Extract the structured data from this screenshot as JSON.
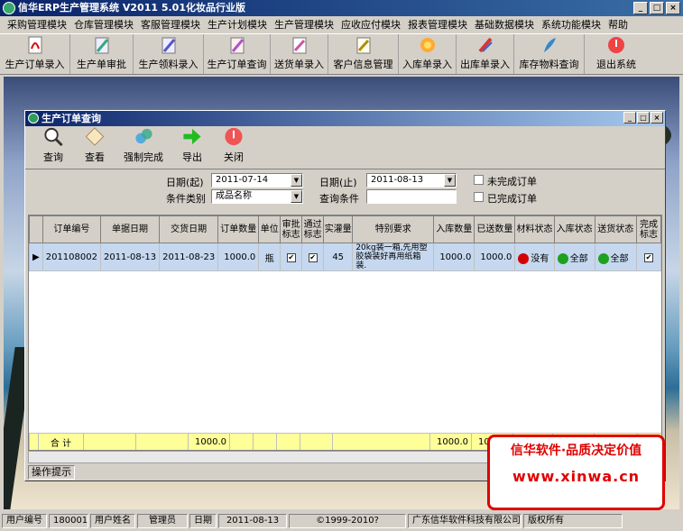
{
  "app": {
    "title": "信华ERP生产管理系统  V2011 5.01化妆品行业版"
  },
  "menu": [
    "采购管理模块",
    "仓库管理模块",
    "客服管理模块",
    "生产计划模块",
    "生产管理模块",
    "应收应付模块",
    "报表管理模块",
    "基础数据模块",
    "系统功能模块",
    "帮助"
  ],
  "toolbar": [
    {
      "label": "生产订单录入",
      "icon": "pdf-document-icon"
    },
    {
      "label": "生产单审批",
      "icon": "pen-approve-icon"
    },
    {
      "label": "生产领料录入",
      "icon": "pen-document-icon"
    },
    {
      "label": "生产订单查询",
      "icon": "pen-search-icon"
    },
    {
      "label": "送货单录入",
      "icon": "delivery-document-icon"
    },
    {
      "label": "客户信息管理",
      "icon": "customer-pen-icon"
    },
    {
      "label": "入库单录入",
      "icon": "flower-document-icon"
    },
    {
      "label": "出库单录入",
      "icon": "outbound-pen-icon"
    },
    {
      "label": "库存物料查询",
      "icon": "feather-pen-icon"
    },
    {
      "label": "退出系统",
      "icon": "exit-icon"
    }
  ],
  "child": {
    "title": "生产订单查询",
    "tools": [
      {
        "label": "查询",
        "icon": "magnifier-icon"
      },
      {
        "label": "查看",
        "icon": "view-diamond-icon"
      },
      {
        "label": "强制完成",
        "icon": "force-complete-icon"
      },
      {
        "label": "导出",
        "icon": "export-arrow-icon"
      },
      {
        "label": "关闭",
        "icon": "close-power-icon"
      }
    ],
    "filters": {
      "date_from_label": "日期(起)",
      "date_from": "2011-07-14",
      "date_to_label": "日期(止)",
      "date_to": "2011-08-13",
      "category_label": "条件类别",
      "category": "成品名称",
      "query_label": "查询条件",
      "query": "",
      "unfinished_label": "未完成订单",
      "finished_label": "已完成订单"
    },
    "columns": [
      "订单编号",
      "单据日期",
      "交货日期",
      "订单数量",
      "单位",
      "审批标志",
      "通过标志",
      "实灌量",
      "特别要求",
      "入库数量",
      "已送数量",
      "材料状态",
      "入库状态",
      "送货状态",
      "完成标志"
    ],
    "rows": [
      {
        "order_no": "201108002",
        "doc_date": "2011-08-13",
        "delivery_date": "2011-08-23",
        "qty": "1000.0",
        "unit": "瓶",
        "approved": true,
        "passed": true,
        "filled": "45",
        "special": "20kg装一箱,先用塑胶袋装好再用纸箱装.",
        "stock_in": "1000.0",
        "sent": "1000.0",
        "material_status": "没有",
        "material_color": "#d40000",
        "in_status": "全部",
        "in_color": "#1fa01f",
        "send_status": "全部",
        "send_color": "#1fa01f",
        "done": true
      }
    ],
    "totals": {
      "label": "合 计",
      "qty": "1000.0",
      "stock_in": "1000.0",
      "sent": "1000.0"
    },
    "status_hint": "操作提示"
  },
  "watermark": {
    "line1": "信华软件·品质决定价值",
    "line2": "www.xinwa.cn"
  },
  "statusbar": {
    "user_no_label": "用户编号",
    "user_no": "180001",
    "user_name_label": "用户姓名",
    "user_name": "管理员",
    "date_label": "日期",
    "date": "2011-08-13",
    "copyright": "©1999-2010?",
    "company": "广东信华软件科技有限公司",
    "rights": "版权所有"
  }
}
